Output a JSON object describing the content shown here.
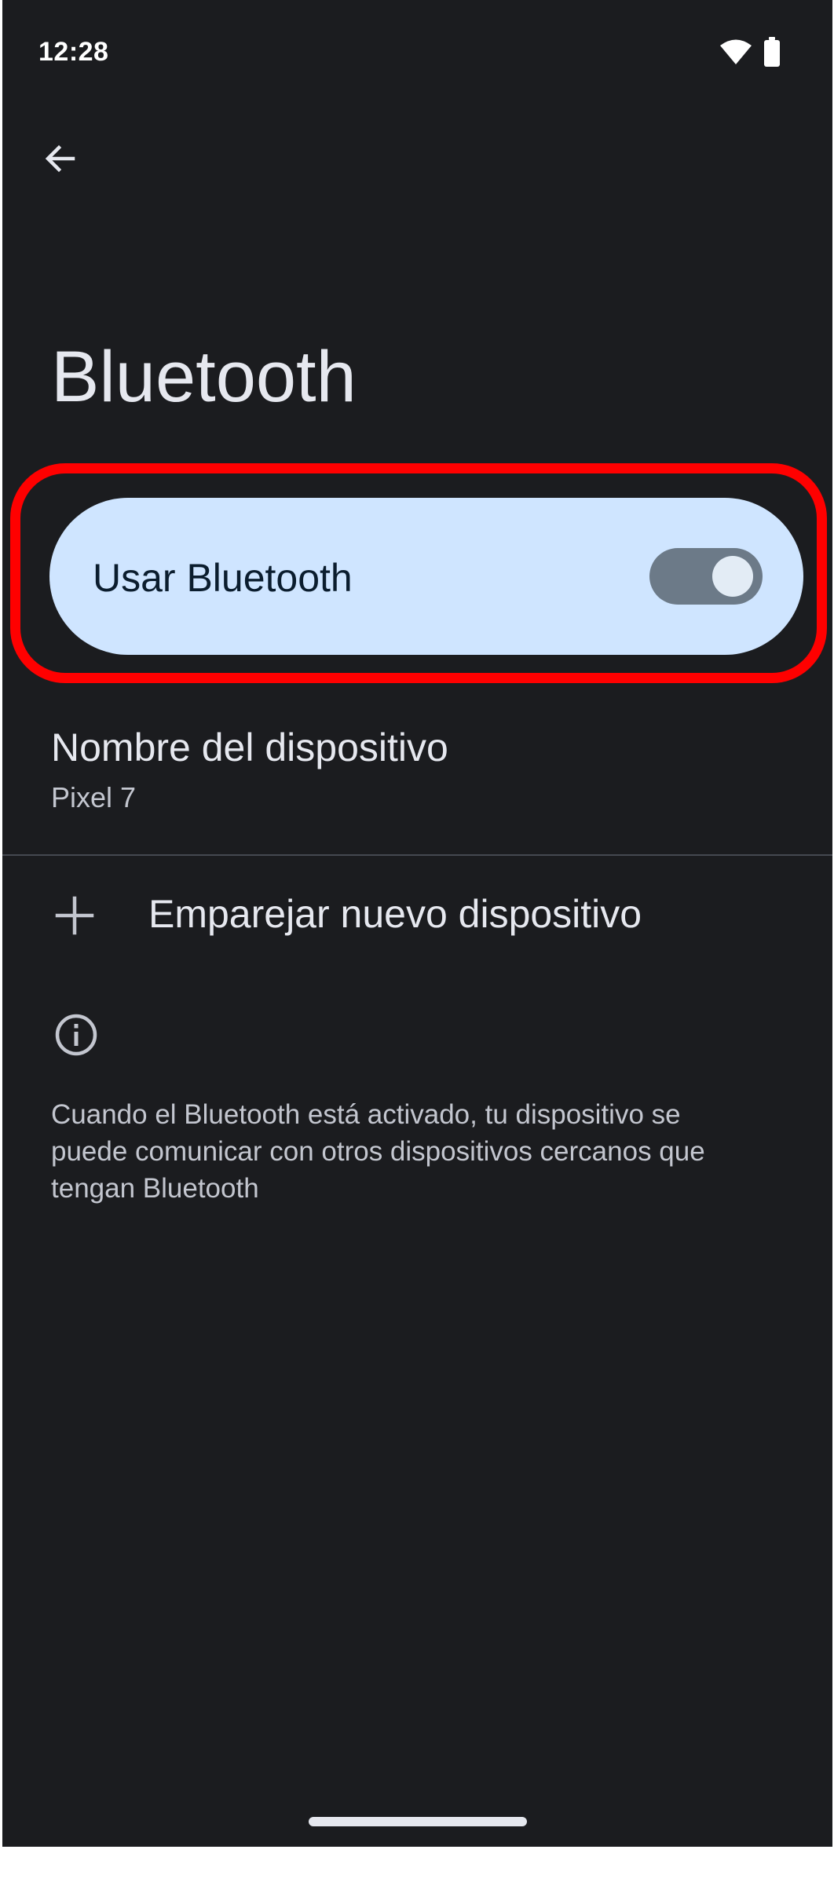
{
  "status_bar": {
    "time": "12:28",
    "wifi_icon": "wifi-icon",
    "battery_icon": "battery-icon"
  },
  "nav": {
    "back_icon": "arrow-back-icon"
  },
  "page": {
    "title": "Bluetooth"
  },
  "bluetooth_toggle": {
    "label": "Usar Bluetooth",
    "enabled": true
  },
  "device_name": {
    "title": "Nombre del dispositivo",
    "value": "Pixel 7"
  },
  "pair_new": {
    "icon": "plus-icon",
    "label": "Emparejar nuevo dispositivo"
  },
  "info": {
    "icon": "info-icon",
    "text": "Cuando el Bluetooth está activado, tu dispositivo se puede comunicar con otros dispositivos cercanos que tengan Bluetooth"
  },
  "colors": {
    "background": "#1b1c1f",
    "toggle_card": "#cfe5ff",
    "switch_track": "#6c7a88",
    "highlight": "#ff0000"
  }
}
